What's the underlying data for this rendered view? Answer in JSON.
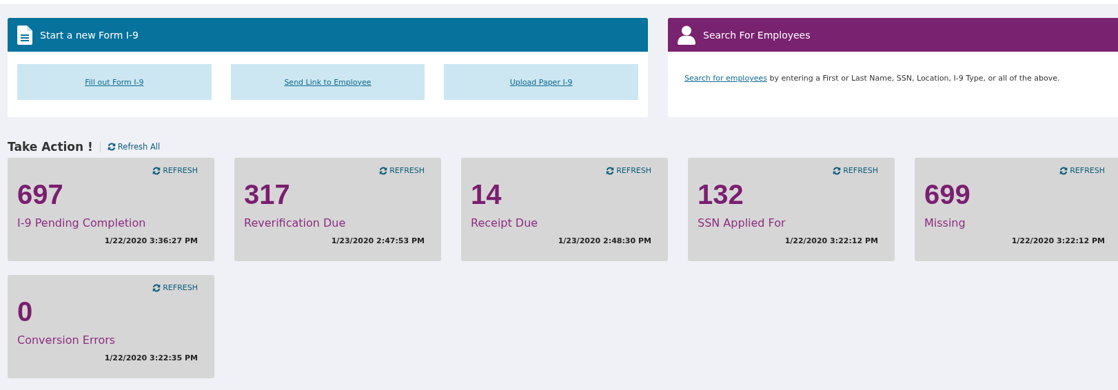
{
  "form_panel": {
    "title": "Start a new Form I-9",
    "actions": [
      "Fill out Form I-9",
      "Send Link to Employee",
      "Upload Paper I-9"
    ]
  },
  "search_panel": {
    "title": "Search For Employees",
    "link": "Search for employees",
    "text": " by entering a First or Last Name, SSN, Location, I-9 Type, or all of the above."
  },
  "take_action": {
    "title": "Take Action !",
    "refresh_all": "Refresh All",
    "cards": [
      {
        "refresh": "REFRESH",
        "count": "697",
        "label": "I-9 Pending Completion",
        "timestamp": "1/22/2020 3:36:27 PM"
      },
      {
        "refresh": "REFRESH",
        "count": "317",
        "label": "Reverification Due",
        "timestamp": "1/23/2020 2:47:53 PM"
      },
      {
        "refresh": "REFRESH",
        "count": "14",
        "label": "Receipt Due",
        "timestamp": "1/23/2020 2:48:30 PM"
      },
      {
        "refresh": "REFRESH",
        "count": "132",
        "label": "SSN Applied For",
        "timestamp": "1/22/2020 3:22:12 PM"
      },
      {
        "refresh": "REFRESH",
        "count": "699",
        "label": "Missing",
        "timestamp": "1/22/2020 3:22:12 PM"
      },
      {
        "refresh": "REFRESH",
        "count": "0",
        "label": "Conversion Errors",
        "timestamp": "1/22/2020 3:22:35 PM"
      }
    ]
  }
}
